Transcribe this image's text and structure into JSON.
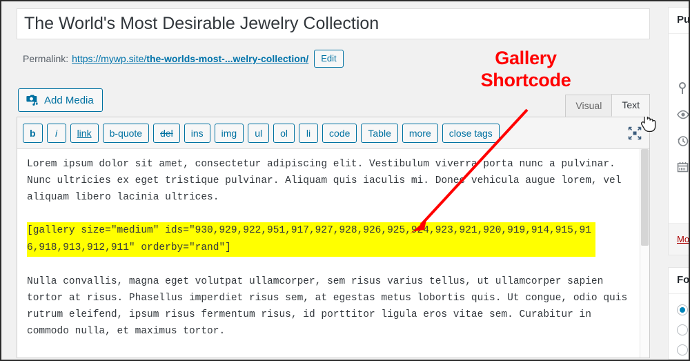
{
  "post": {
    "title": "The World's Most Desirable Jewelry Collection",
    "permalink_label": "Permalink:",
    "permalink_base": "https://mywp.site/",
    "permalink_slug": "the-worlds-most-...welry-collection/",
    "edit_button": "Edit"
  },
  "toolbar": {
    "add_media": "Add Media",
    "add_media_icon": "media-camera-music-icon",
    "dfw_icon": "distraction-free-expand-icon"
  },
  "tabs": [
    {
      "label": "Visual",
      "active": false
    },
    {
      "label": "Text",
      "active": true
    }
  ],
  "quicktags": [
    {
      "label": "b",
      "style": "b"
    },
    {
      "label": "i",
      "style": "i"
    },
    {
      "label": "link",
      "style": "link"
    },
    {
      "label": "b-quote",
      "style": ""
    },
    {
      "label": "del",
      "style": "del"
    },
    {
      "label": "ins",
      "style": ""
    },
    {
      "label": "img",
      "style": ""
    },
    {
      "label": "ul",
      "style": ""
    },
    {
      "label": "ol",
      "style": ""
    },
    {
      "label": "li",
      "style": ""
    },
    {
      "label": "code",
      "style": ""
    },
    {
      "label": "Table",
      "style": ""
    },
    {
      "label": "more",
      "style": ""
    },
    {
      "label": "close tags",
      "style": ""
    }
  ],
  "content": {
    "paragraph_1": "Lorem ipsum dolor sit amet, consectetur adipiscing elit. Vestibulum viverra porta nunc a pulvinar. Nunc ultricies ex eget tristique pulvinar. Aliquam quis iaculis mi. Donec vehicula augue lorem, vel aliquam libero lacinia ultrices.",
    "shortcode": "[gallery size=\"medium\" ids=\"930,929,922,951,917,927,928,926,925,924,923,921,920,919,914,915,916,918,913,912,911\" orderby=\"rand\"]",
    "shortcode_highlight_color": "#ffff00",
    "paragraph_2": "Nulla convallis, magna eget volutpat ullamcorper, sem risus varius tellus, ut ullamcorper sapien tortor at risus. Phasellus imperdiet risus sem, at egestas metus lobortis quis. Ut congue, odio quis rutrum eleifend, ipsum risus fermentum risus, id porttitor ligula eros vitae sem. Curabitur in commodo nulla, et maximus tortor."
  },
  "annotation": {
    "line_1": "Gallery",
    "line_2": "Shortcode",
    "color": "#ff0000",
    "arrow": "red-arrow-pointing-to-shortcode"
  },
  "sidebar": {
    "publish_panel": {
      "title": "Pu",
      "rows": [
        {
          "icon": "pin-sticky-icon"
        },
        {
          "icon": "eye-visibility-icon"
        },
        {
          "icon": "clock-revisions-icon"
        },
        {
          "icon": "calendar-publish-icon"
        }
      ],
      "trash_link": "Mo"
    },
    "format_panel": {
      "title": "Fo",
      "options": [
        {
          "checked": true
        },
        {
          "checked": false
        },
        {
          "checked": false
        }
      ]
    }
  },
  "cursor": {
    "icon": "pointer-hand-cursor"
  }
}
